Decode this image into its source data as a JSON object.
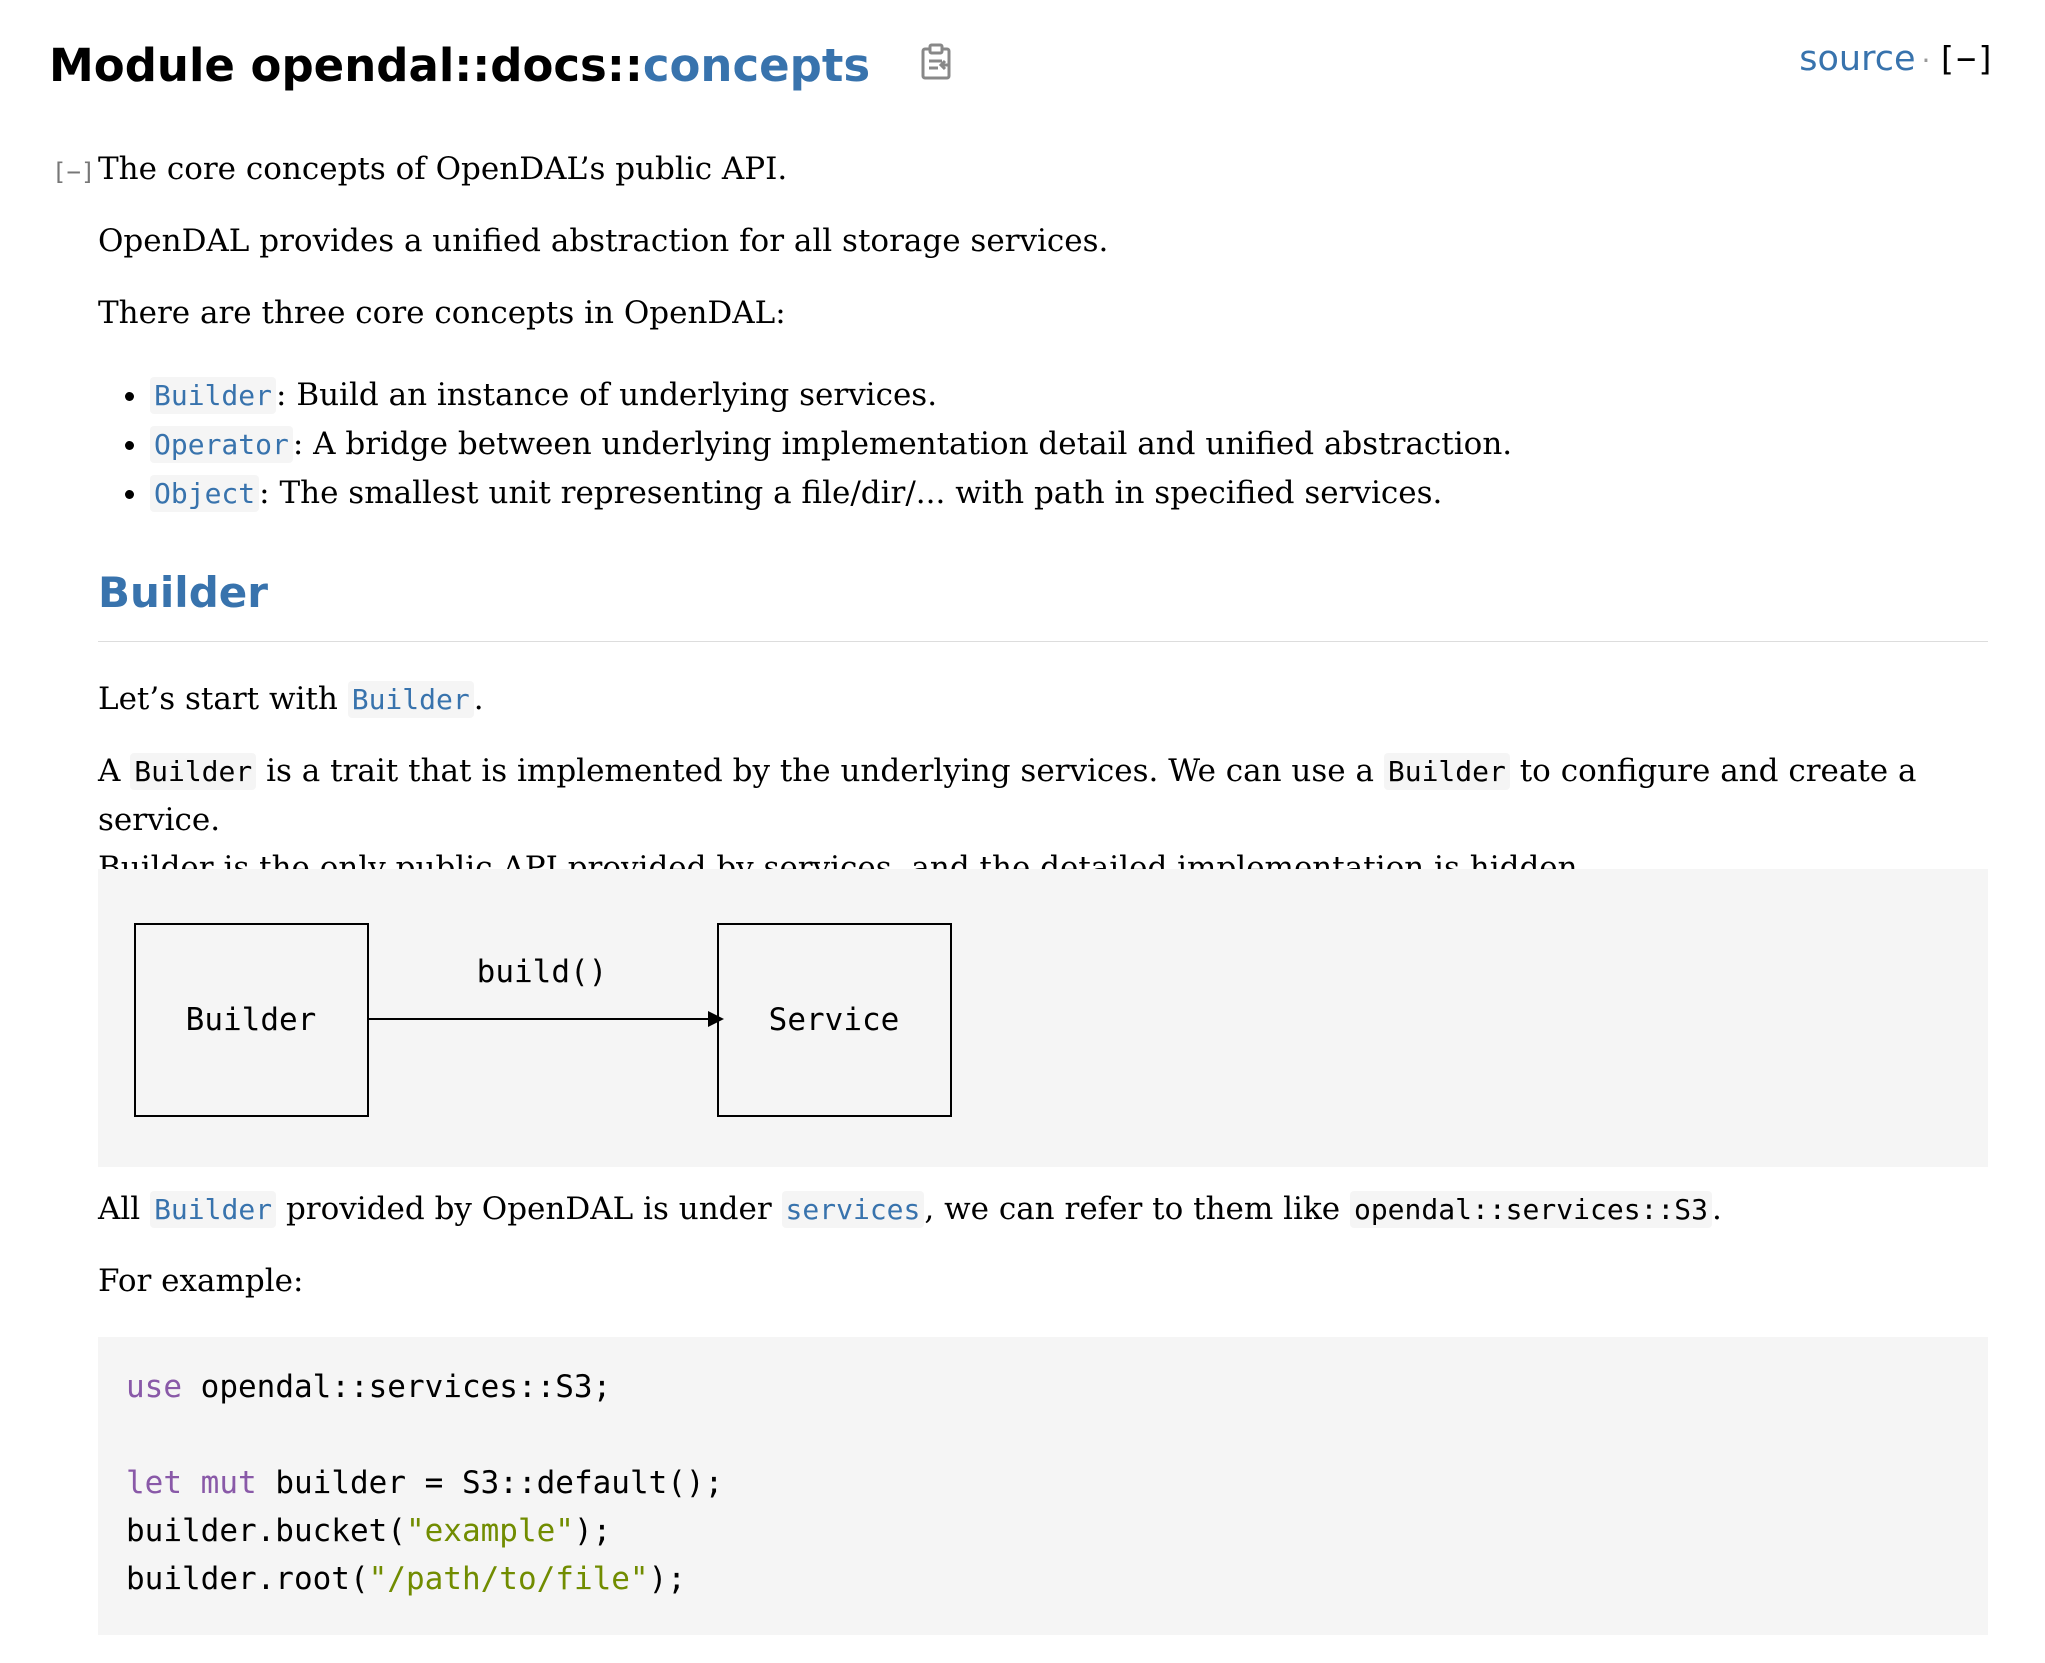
{
  "header": {
    "title_prefix": "Module opendal::docs::",
    "title_link": "concepts",
    "source_label": "source",
    "separator": "·",
    "collapse_label": "[−]"
  },
  "doc": {
    "toggle": "[−]",
    "intro": "The core concepts of OpenDAL’s public API.",
    "p_unified": "OpenDAL provides a unified abstraction for all storage services.",
    "p_three": "There are three core concepts in OpenDAL:",
    "concepts": [
      {
        "name": "Builder",
        "desc": ": Build an instance of underlying services."
      },
      {
        "name": "Operator",
        "desc": ": A bridge between underlying implementation detail and unified abstraction."
      },
      {
        "name": "Object",
        "desc": ": The smallest unit representing a file/dir/... with path in specified services."
      }
    ],
    "section_heading": "Builder",
    "p_start_prefix": "Let’s start with ",
    "p_start_code": "Builder",
    "p_start_suffix": ".",
    "p_trait": {
      "t1": "A ",
      "c1": "Builder",
      "t2": " is a trait that is implemented by the underlying services. We can use a ",
      "c2": "Builder",
      "t3": " to configure and create a service.",
      "line2": "Builder is the only public API provided by services, and the detailed implementation is hidden."
    },
    "diagram": {
      "left_box": "Builder",
      "right_box": "Service",
      "arrow_label": "build()"
    },
    "p_all": {
      "t1": "All ",
      "c1": "Builder",
      "t2": " provided by OpenDAL is under ",
      "c2": "services",
      "t3": ", we can refer to them like ",
      "c3": "opendal::services::S3",
      "t4": "."
    },
    "p_example": "For example:",
    "code": {
      "line1_kw": "use",
      "line1_rest": " opendal::services::S3;",
      "line3_kw1": "let",
      "line3_kw2": "mut",
      "line3_rest": " builder = S3::default();",
      "line4_pre": "builder.bucket(",
      "line4_str": "\"example\"",
      "line4_post": ");",
      "line5_pre": "builder.root(",
      "line5_str": "\"/path/to/file\"",
      "line5_post": ");"
    }
  }
}
